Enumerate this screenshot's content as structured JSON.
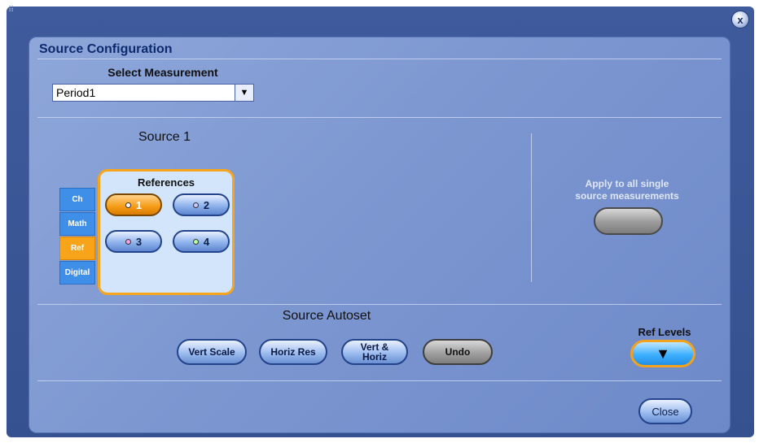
{
  "window": {
    "close_glyph": "x",
    "grip_icon": "resize-grip-icon"
  },
  "panel": {
    "title": "Source Configuration"
  },
  "select_measurement": {
    "label": "Select Measurement",
    "value": "Period1",
    "arrow_glyph": "▼"
  },
  "source": {
    "title": "Source 1",
    "tabs": [
      {
        "label": "Ch",
        "active": false
      },
      {
        "label": "Math",
        "active": false
      },
      {
        "label": "Ref",
        "active": true
      },
      {
        "label": "Digital",
        "active": false
      }
    ],
    "references": {
      "title": "References",
      "buttons": [
        {
          "label": "1",
          "selected": true,
          "dot_color": "#ffffff"
        },
        {
          "label": "2",
          "selected": false,
          "dot_color": "#c8c8ff"
        },
        {
          "label": "3",
          "selected": false,
          "dot_color": "#ff9be8"
        },
        {
          "label": "4",
          "selected": false,
          "dot_color": "#b8ff9e"
        }
      ]
    }
  },
  "apply_all": {
    "label_line1": "Apply to all single",
    "label_line2": "source measurements"
  },
  "autoset": {
    "title": "Source Autoset",
    "buttons": [
      {
        "label": "Vert Scale"
      },
      {
        "label": "Horiz Res"
      },
      {
        "label_line1": "Vert &",
        "label_line2": "Horiz"
      },
      {
        "label": "Undo"
      }
    ]
  },
  "ref_levels": {
    "label": "Ref Levels",
    "arrow_glyph": "▼"
  },
  "footer": {
    "close_label": "Close"
  },
  "colors": {
    "accent_orange": "#f6a51d",
    "tab_blue": "#3f8fe8",
    "panel_title": "#0d2a6e"
  }
}
